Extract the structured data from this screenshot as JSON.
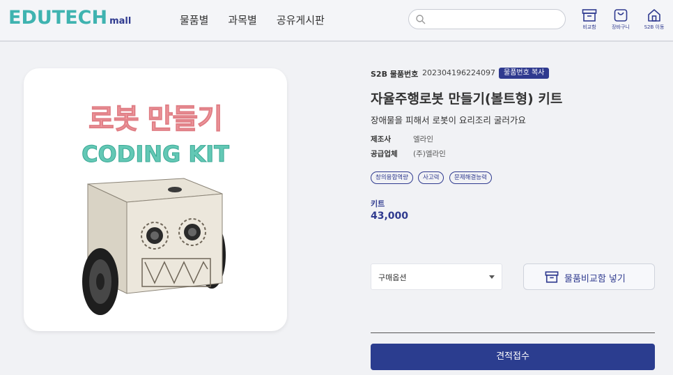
{
  "header": {
    "logo_main": "EDUTECH",
    "logo_sub": "mall",
    "nav": [
      "물품별",
      "과목별",
      "공유게시판"
    ],
    "search_placeholder": "",
    "icons": [
      {
        "icon": "archive-icon",
        "label": "비교함"
      },
      {
        "icon": "shopping-bag-icon",
        "label": "장바구니"
      },
      {
        "icon": "home-icon",
        "label": "S2B 이동"
      }
    ]
  },
  "product_image": {
    "title_line1": "로봇 만들기",
    "title_line2": "CODING KIT"
  },
  "product": {
    "s2b_label": "S2B 물품번호",
    "s2b_number": "202304196224097",
    "copy_button": "물품번호 복사",
    "title": "자율주행로봇 만들기(볼트형) 키트",
    "subtitle": "장애물을 피해서 로봇이 요리조리 굴러가요",
    "meta": [
      {
        "key": "제조사",
        "value": "엘라인"
      },
      {
        "key": "공급업체",
        "value": "(주)엘라인"
      }
    ],
    "tags": [
      "창의융합역량",
      "사고력",
      "문제해결능력"
    ],
    "price_label": "키트",
    "price": "43,000"
  },
  "actions": {
    "option_select": "구매옵션",
    "compare_button": "물품비교함 넣기",
    "quote_button": "견적접수"
  },
  "colors": {
    "brand_navy": "#2f3a8f",
    "brand_teal": "#3fb3b0"
  }
}
